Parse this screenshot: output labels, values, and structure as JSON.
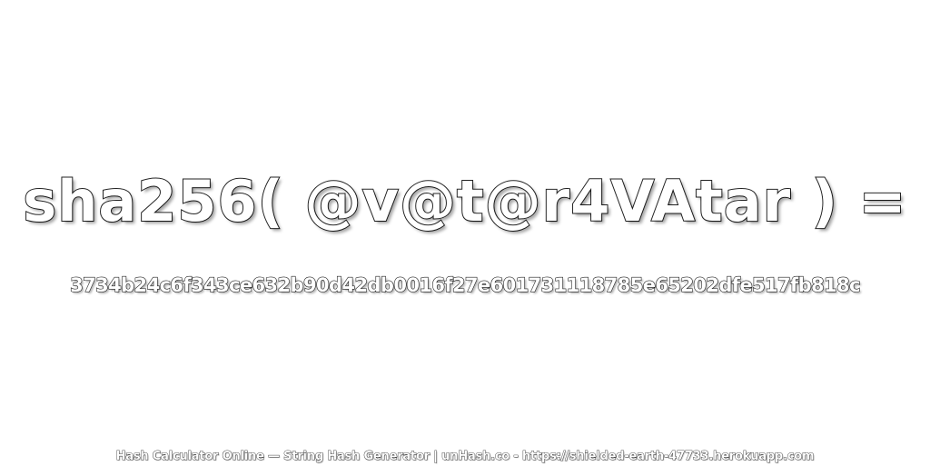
{
  "heading": {
    "expression": "sha256( @v@t@r4VAtar ) ="
  },
  "result": {
    "hash": "3734b24c6f343ce632b90d42db0016f27e601731118785e65202dfe517fb818c"
  },
  "footer": {
    "credit": "Hash Calculator Online — String Hash Generator | unHash.co - https://shielded-earth-47733.herokuapp.com"
  },
  "colors": {
    "background": "#ffffff",
    "text_fill": "#ffffff",
    "text_outline": "#222222"
  }
}
